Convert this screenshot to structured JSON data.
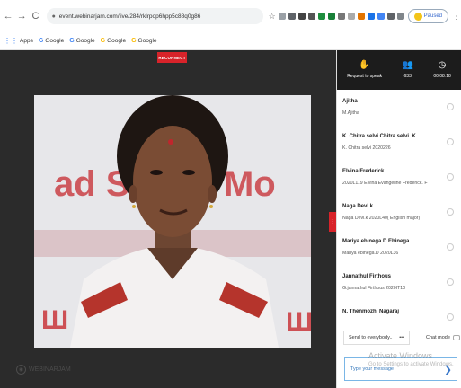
{
  "browser": {
    "back": "←",
    "forward": "→",
    "reload": "C",
    "url": "event.webinarjam.com/live/284/rklrpop6hpp5c88q0g86",
    "paused_label": "Paused",
    "bookmarks": [
      {
        "label": "Apps",
        "icon": "apps-grid-icon"
      },
      {
        "label": "Google",
        "icon": "google-icon"
      },
      {
        "label": "Google",
        "icon": "google-icon"
      },
      {
        "label": "Google",
        "icon": "google-icon"
      },
      {
        "label": "Google",
        "icon": "google-icon"
      }
    ]
  },
  "stage": {
    "reconnect_label": "RECONNECT",
    "watermark": "WEBINARJAM",
    "banner_text": "ad Safety Mo"
  },
  "panel": {
    "header": {
      "request": "Request to speak",
      "count": "633",
      "timer": "00:08:18"
    },
    "participants": [
      {
        "name": "Ajitha",
        "sub": "M.Ajitha"
      },
      {
        "name": "K. Chitra selvi Chitra selvi. K",
        "sub": "K. Chitra selvi 2020226"
      },
      {
        "name": "Elvina Frederick",
        "sub": "2020L119 Elvina Evangeline Frederick. F"
      },
      {
        "name": "Naga Devi.k",
        "sub": "Naga Devi.k 2020L40( English major)"
      },
      {
        "name": "Mariya ebinega.D Ebinega",
        "sub": "Mariya ebinega.D 2020L36"
      },
      {
        "name": "Jannathul Firthous",
        "sub": "G.jannathul Firthous 2020IT10"
      },
      {
        "name": "N. Thenmozhi Nagaraj",
        "sub": ""
      }
    ],
    "send_to": "Send to everybody..",
    "send_dots": "•••",
    "chat_mode": "Chat mode",
    "message_placeholder": "Type your message",
    "activate_title": "Activate Windows",
    "activate_sub": "Go to Settings to activate Windows."
  }
}
